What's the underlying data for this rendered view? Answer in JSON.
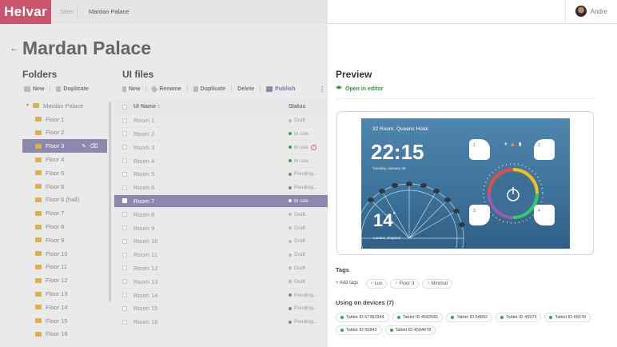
{
  "topbar": {
    "logo": "Helvar",
    "breadcrumb_sites": "Sites",
    "breadcrumb_current": "Mardan Palace",
    "user_name": "Andre"
  },
  "page": {
    "title": "Mardan Palace",
    "back_icon": "arrow-left-icon"
  },
  "folders": {
    "title": "Folders",
    "toolbar": {
      "new": "New",
      "duplicate": "Duplicate"
    },
    "root": "Mardan Palace",
    "items": [
      "Floor 1",
      "Floor 2",
      "Floor 3",
      "Floor 4",
      "Floor 5",
      "Floor 6",
      "Floor 6 (hall)",
      "Floor 7",
      "Floor 8",
      "Floor 9",
      "Floor 10",
      "Floor 11",
      "Floor 12",
      "Floor 13",
      "Floor 14",
      "Floor 15",
      "Floor 16"
    ],
    "selected_index": 2
  },
  "files": {
    "title": "UI files",
    "toolbar": {
      "new": "New",
      "rename": "Rename",
      "duplicate": "Duplicate",
      "delete": "Delete",
      "publish": "Publish"
    },
    "columns": {
      "name": "UI Name",
      "status": "Status"
    },
    "rows": [
      {
        "name": "Room 1",
        "status": "Draft"
      },
      {
        "name": "Room 2",
        "status": "In use"
      },
      {
        "name": "Room 3",
        "status": "In use"
      },
      {
        "name": "Room 4",
        "status": "In use"
      },
      {
        "name": "Room 5",
        "status": "Pending..."
      },
      {
        "name": "Room 6",
        "status": "Pending..."
      },
      {
        "name": "Room 7",
        "status": "In use"
      },
      {
        "name": "Room 8",
        "status": "Draft"
      },
      {
        "name": "Room 9",
        "status": "Draft"
      },
      {
        "name": "Room 10",
        "status": "Draft"
      },
      {
        "name": "Room 11",
        "status": "Draft"
      },
      {
        "name": "Room 12",
        "status": "Draft"
      },
      {
        "name": "Room 13",
        "status": "Draft"
      },
      {
        "name": "Room 14",
        "status": "Pending..."
      },
      {
        "name": "Room 15",
        "status": "Pending..."
      },
      {
        "name": "Room 16",
        "status": "Pending..."
      }
    ],
    "selected_index": 6
  },
  "preview": {
    "title": "Preview",
    "open_in_editor": "Open in editor",
    "screen": {
      "room": "32 Room, Queens Hotel",
      "time": "22:15",
      "date": "Tuesday, January 30",
      "temperature": "14",
      "location": "London, England",
      "button_numbers": [
        "1",
        "2",
        "3",
        "4"
      ]
    }
  },
  "tags": {
    "title": "Tags",
    "add_label": "Add tags",
    "items": [
      "Lux",
      "Floor 3",
      "Minimal"
    ]
  },
  "devices": {
    "title": "Using on devices (7)",
    "items": [
      "Tablet ID 67382944",
      "Tablet ID 4582681",
      "Tablet ID 54892",
      "Tablet ID 45973",
      "Tablet ID 45678",
      "Tablet ID 56843",
      "Tablet ID 4584678"
    ]
  },
  "colors": {
    "brand": "#c9556d",
    "selection": "#8c88ae",
    "in_use": "#3aa54a",
    "draft": "#bbbbbb",
    "pending": "#888888",
    "folder": "#d9b24a"
  }
}
